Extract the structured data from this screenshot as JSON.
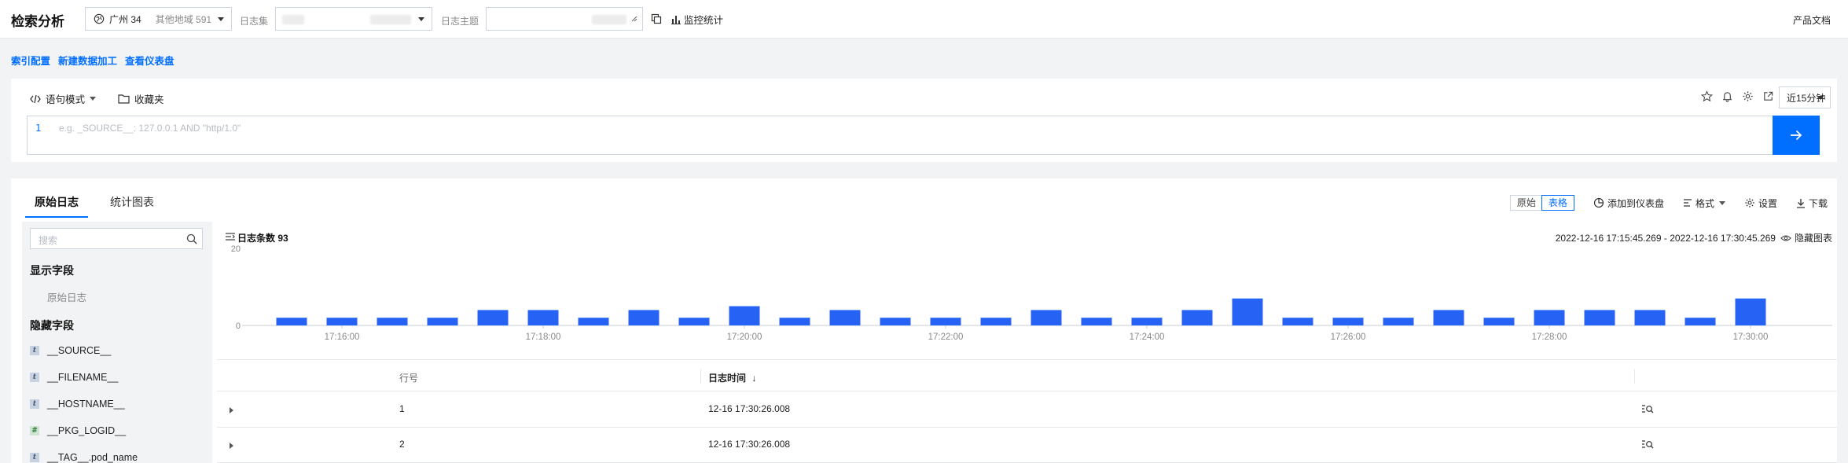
{
  "topbar": {
    "title": "检索分析",
    "region_current": "广州 34",
    "region_other": "其他地域 591",
    "logset_label": "日志集",
    "topic_label": "日志主题",
    "monitor_label": "监控统计",
    "docs_label": "产品文档"
  },
  "links": [
    "索引配置",
    "新建数据加工",
    "查看仪表盘"
  ],
  "query": {
    "mode_label": "语句模式",
    "favorites_label": "收藏夹",
    "time_range": "近15分钟",
    "line_number": "1",
    "placeholder": "e.g. _SOURCE__: 127.0.0.1 AND \"http/1.0\""
  },
  "result": {
    "tabs": [
      "原始日志",
      "统计图表"
    ],
    "view_raw": "原始",
    "view_table": "表格",
    "add_dashboard": "添加到仪表盘",
    "format_label": "格式",
    "settings_label": "设置",
    "download_label": "下载"
  },
  "sidebar": {
    "search_placeholder": "搜索",
    "shown_header": "显示字段",
    "shown_items": [
      "原始日志"
    ],
    "hidden_header": "隐藏字段",
    "hidden_items": [
      {
        "type": "t",
        "name": "__SOURCE__"
      },
      {
        "type": "t",
        "name": "__FILENAME__"
      },
      {
        "type": "t",
        "name": "__HOSTNAME__"
      },
      {
        "type": "#",
        "name": "__PKG_LOGID__"
      },
      {
        "type": "t",
        "name": "__TAG__.pod_name"
      }
    ]
  },
  "histogram": {
    "count_label": "日志条数 93",
    "range": "2022-12-16 17:15:45.269 - 2022-12-16 17:30:45.269",
    "hide_label": "隐藏图表"
  },
  "chart_data": {
    "type": "bar",
    "color": "#2663f5",
    "ylim": [
      0,
      20
    ],
    "y_ticks": [
      "20",
      "0"
    ],
    "x_ticks": [
      "17:16:00",
      "17:18:00",
      "17:20:00",
      "17:22:00",
      "17:24:00",
      "17:26:00",
      "17:28:00",
      "17:30:00"
    ],
    "values": [
      2,
      2,
      2,
      2,
      4,
      4,
      2,
      4,
      2,
      5,
      2,
      4,
      2,
      2,
      2,
      4,
      2,
      2,
      4,
      7,
      2,
      2,
      2,
      4,
      2,
      4,
      4,
      4,
      2,
      7
    ]
  },
  "table": {
    "columns": [
      "行号",
      "日志时间"
    ],
    "sort_indicator": "↓",
    "rows": [
      {
        "line": "1",
        "time": "12-16 17:30:26.008"
      },
      {
        "line": "2",
        "time": "12-16 17:30:26.008"
      }
    ]
  }
}
